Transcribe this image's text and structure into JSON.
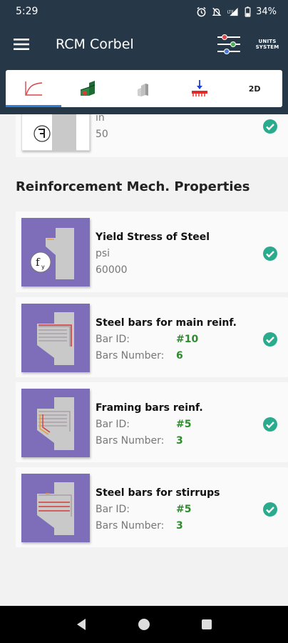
{
  "status": {
    "time": "5:29",
    "network": "LTE",
    "battery": "34%"
  },
  "app": {
    "title": "RCM Corbel",
    "units_line1": "UNITS",
    "units_line2": "SYSTEM"
  },
  "tabs": [
    {
      "icon": "curve-chart-icon",
      "active": true
    },
    {
      "icon": "corbel-3d-icon",
      "active": false
    },
    {
      "icon": "column-block-icon",
      "active": false
    },
    {
      "icon": "load-arrow-icon",
      "active": false
    },
    {
      "label": "2D",
      "active": false
    }
  ],
  "top_card": {
    "line1": "in",
    "line2": "50"
  },
  "section": {
    "title": "Reinforcement Mech. Properties"
  },
  "cards": [
    {
      "title": "Yield Stress of Steel",
      "line1": "psi",
      "line2": "60000"
    },
    {
      "title": "Steel bars for main reinf.",
      "label1": "Bar ID:",
      "value1": "#10",
      "label2": "Bars Number:",
      "value2": "6"
    },
    {
      "title": "Framing bars reinf.",
      "label1": "Bar ID:",
      "value1": "#5",
      "label2": "Bars Number:",
      "value2": "3"
    },
    {
      "title": "Steel bars for stirrups",
      "label1": "Bar ID:",
      "value1": "#5",
      "label2": "Bars Number:",
      "value2": "3"
    }
  ],
  "colors": {
    "appbar": "#263848",
    "accent_tab": "#2f7fd6",
    "thumb": "#7e6db8",
    "check": "#2bab8e",
    "value_green": "#2e8b2e"
  }
}
